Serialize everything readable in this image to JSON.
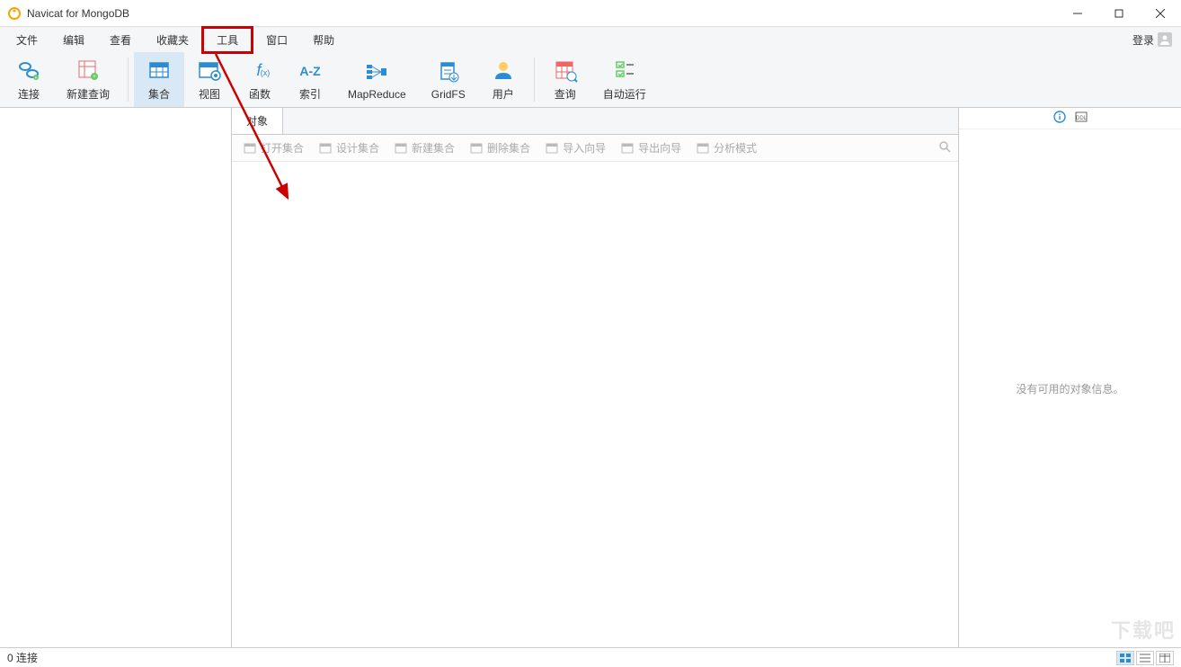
{
  "app": {
    "title": "Navicat for MongoDB"
  },
  "menubar": {
    "items": [
      "文件",
      "编辑",
      "查看",
      "收藏夹",
      "工具",
      "窗口",
      "帮助"
    ],
    "highlight_index": 4,
    "login": "登录"
  },
  "toolbar": {
    "buttons": [
      {
        "label": "连接",
        "icon": "connection-icon",
        "active": false
      },
      {
        "label": "新建查询",
        "icon": "new-query-icon",
        "active": false
      },
      {
        "label": "集合",
        "icon": "collection-icon",
        "active": true
      },
      {
        "label": "视图",
        "icon": "view-icon",
        "active": false
      },
      {
        "label": "函数",
        "icon": "function-icon",
        "active": false
      },
      {
        "label": "索引",
        "icon": "index-icon",
        "active": false
      },
      {
        "label": "MapReduce",
        "icon": "mapreduce-icon",
        "active": false
      },
      {
        "label": "GridFS",
        "icon": "gridfs-icon",
        "active": false
      },
      {
        "label": "用户",
        "icon": "user-icon",
        "active": false
      },
      {
        "label": "查询",
        "icon": "query-icon",
        "active": false
      },
      {
        "label": "自动运行",
        "icon": "autorun-icon",
        "active": false
      }
    ],
    "separator_after": [
      1,
      8
    ]
  },
  "center": {
    "tab": "对象",
    "toolbar_items": [
      "打开集合",
      "设计集合",
      "新建集合",
      "删除集合",
      "导入向导",
      "导出向导",
      "分析模式"
    ]
  },
  "right": {
    "empty_text": "没有可用的对象信息。"
  },
  "statusbar": {
    "text": "0 连接"
  },
  "watermark": "下载吧"
}
